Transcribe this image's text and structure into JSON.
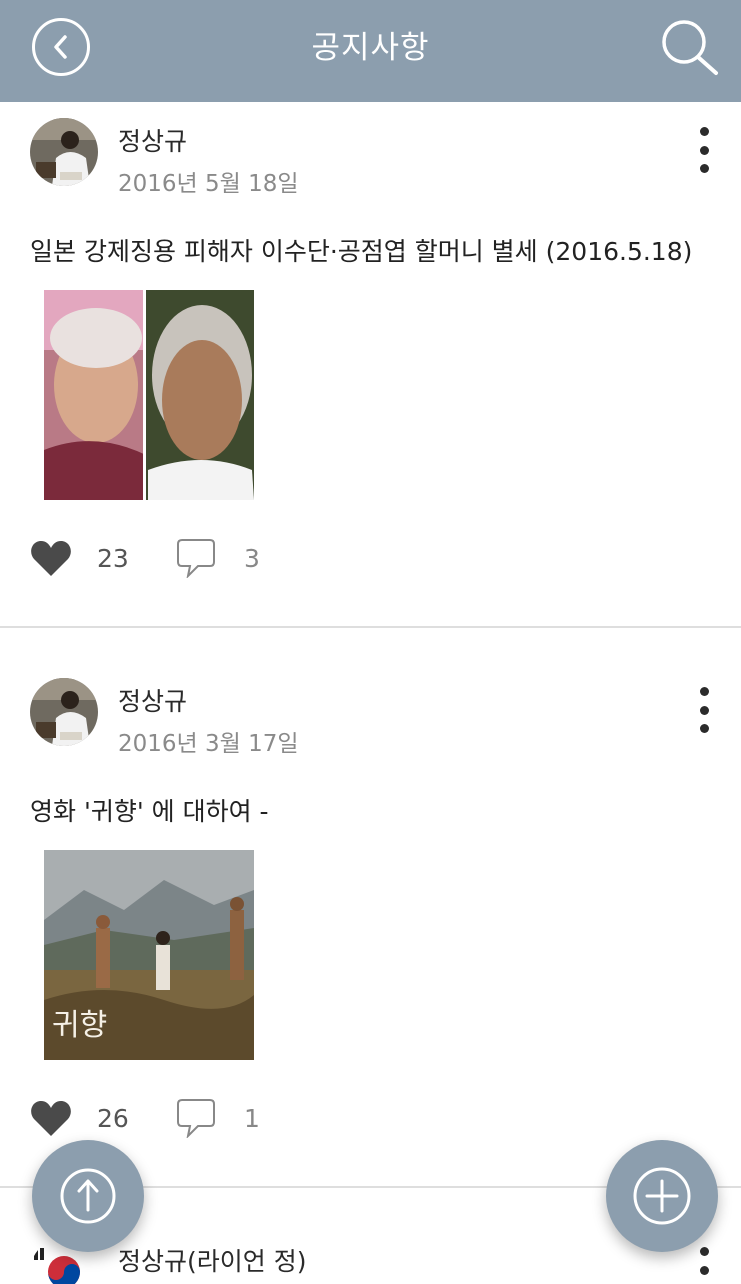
{
  "header": {
    "title": "공지사항",
    "back_icon": "back-chevron-icon",
    "search_icon": "search-icon",
    "bar_color": "#8c9eae"
  },
  "posts": [
    {
      "author": "정상규",
      "date": "2016년 5월 18일",
      "text": "일본 강제징용 피해자 이수단·공점엽 할머니 별세 (2016.5.18)",
      "likes": "23",
      "comments": "3"
    },
    {
      "author": "정상규",
      "date": "2016년 3월 17일",
      "text": "영화 '귀향' 에 대하여 -",
      "image_caption": "귀향",
      "likes": "26",
      "comments": "1"
    },
    {
      "author": "정상규(라이언 정)"
    }
  ],
  "fab": {
    "scroll_top_icon": "arrow-up-icon",
    "add_icon": "plus-icon"
  }
}
